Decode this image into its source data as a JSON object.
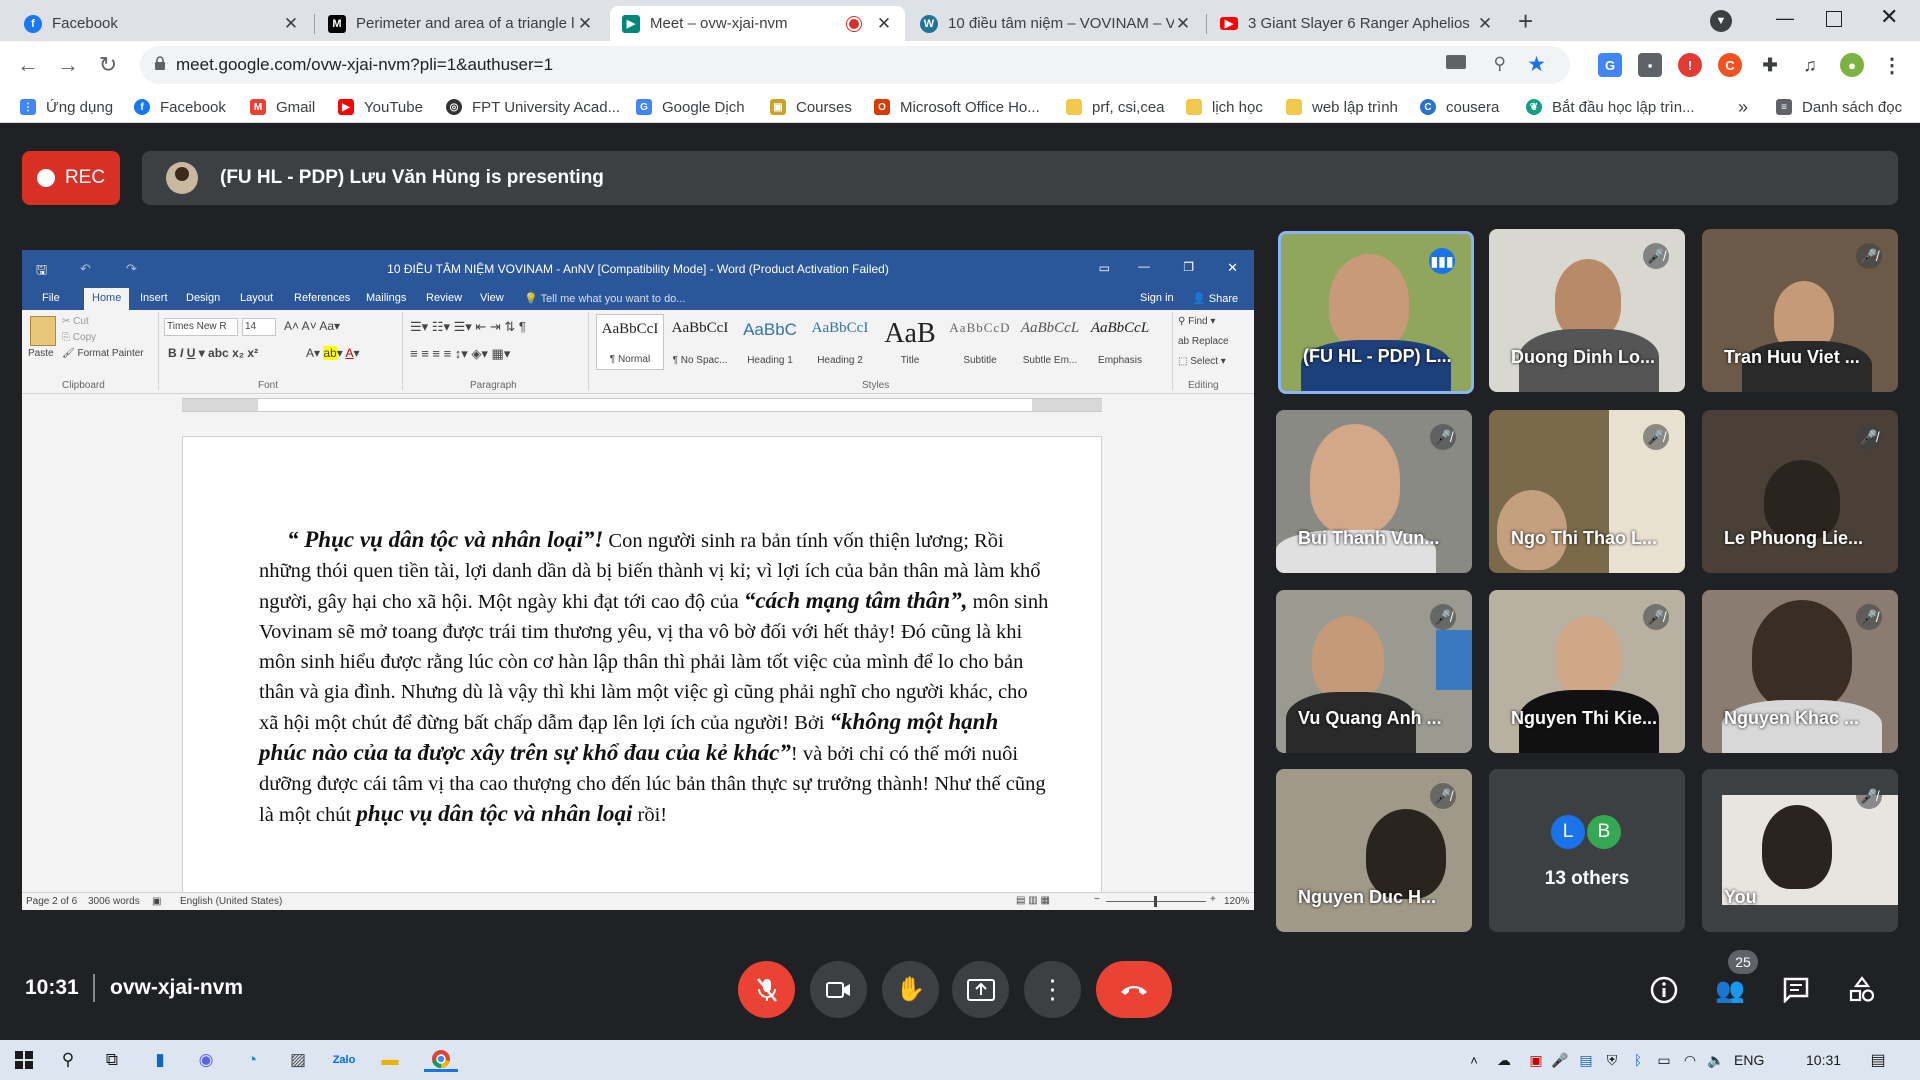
{
  "browser": {
    "tabs": [
      {
        "title": "Facebook",
        "icon": "facebook-icon",
        "color": "#1877f2",
        "glyph": "f"
      },
      {
        "title": "Perimeter and area of a triangle l",
        "icon": "mathway-icon",
        "color": "#000000",
        "glyph": "M"
      },
      {
        "title": "Meet – ovw-xjai-nvm",
        "icon": "meet-icon",
        "color": "#00897b",
        "glyph": "▶"
      },
      {
        "title": "10 điều tâm niệm – VOVINAM – V",
        "icon": "wordpress-icon",
        "color": "#21759b",
        "glyph": "W"
      },
      {
        "title": "3 Giant Slayer 6 Ranger Aphelios",
        "icon": "youtube-icon",
        "color": "#ff0000",
        "glyph": "▶"
      }
    ],
    "new_tab": "+",
    "url": "meet.google.com/ovw-xjai-nvm?pli=1&authuser=1",
    "bookmarks": [
      {
        "label": "Ứng dụng",
        "color": "#4285f4"
      },
      {
        "label": "Facebook",
        "color": "#1877f2"
      },
      {
        "label": "Gmail",
        "color": "#ea4335"
      },
      {
        "label": "YouTube",
        "color": "#ff0000"
      },
      {
        "label": "FPT University Acad...",
        "color": "#333333"
      },
      {
        "label": "Google Dịch",
        "color": "#4285f4"
      },
      {
        "label": "Courses",
        "color": "#c9a227"
      },
      {
        "label": "Microsoft Office Ho...",
        "color": "#d83b01"
      },
      {
        "label": "prf, csi,cea",
        "color": "#f2c94c"
      },
      {
        "label": "lịch học",
        "color": "#f2c94c"
      },
      {
        "label": "web lập trình",
        "color": "#f2c94c"
      },
      {
        "label": "cousera",
        "color": "#2a73cc"
      },
      {
        "label": "Bắt đầu học lập trìn...",
        "color": "#15a085"
      }
    ],
    "bookmarks_more": "»",
    "reading_list": "Danh sách đọc"
  },
  "meet": {
    "rec_label": "REC",
    "presenting": "(FU HL - PDP) Lưu Văn Hùng is presenting",
    "time": "10:31",
    "code": "ovw-xjai-nvm",
    "participants_count": "25",
    "others_label": "13 others",
    "others_avatars": [
      "L",
      "B"
    ],
    "tiles": [
      "(FU HL - PDP) L...",
      "Duong Dinh Lo...",
      "Tran Huu Viet ...",
      "Bui Thanh Vun...",
      "Ngo Thi Thao L...",
      "Le Phuong Lie...",
      "Vu Quang Anh ...",
      "Nguyen Thi Kie...",
      "Nguyen Khac ...",
      "Nguyen Duc H...",
      "You"
    ]
  },
  "word": {
    "title": "10 ĐIỀU TÂM NIỆM VOVINAM - AnNV [Compatibility Mode] - Word (Product Activation Failed)",
    "menu": [
      "File",
      "Home",
      "Insert",
      "Design",
      "Layout",
      "References",
      "Mailings",
      "Review",
      "View"
    ],
    "tell_me": "Tell me what you want to do...",
    "sign_in": "Sign in",
    "share": "Share",
    "clipboard": {
      "paste": "Paste",
      "cut": "Cut",
      "copy": "Copy",
      "format_painter": "Format Painter",
      "group": "Clipboard"
    },
    "font": {
      "name": "Times New R",
      "size": "14",
      "group": "Font"
    },
    "paragraph_group": "Paragraph",
    "styles_group": "Styles",
    "editing_group": "Editing",
    "styles": [
      {
        "sample": "AaBbCcI",
        "name": "¶ Normal"
      },
      {
        "sample": "AaBbCcI",
        "name": "¶ No Spac..."
      },
      {
        "sample": "AaBbC",
        "name": "Heading 1"
      },
      {
        "sample": "AaBbCcI",
        "name": "Heading 2"
      },
      {
        "sample": "AaB",
        "name": "Title"
      },
      {
        "sample": "AaBbCcD",
        "name": "Subtitle"
      },
      {
        "sample": "AaBbCcL",
        "name": "Subtle Em..."
      },
      {
        "sample": "AaBbCcL",
        "name": "Emphasis"
      }
    ],
    "editing": {
      "find": "Find",
      "replace": "Replace",
      "select": "Select"
    },
    "doc": {
      "b1": "“ Phục vụ dân tộc và nhân loại”!",
      "t1": " Con người sinh ra bản tính vốn thiện lương; Rồi những thói quen tiền tài, lợi danh dần dà bị biến thành vị kỉ; vì lợi ích của bản thân mà làm khổ người, gây hại cho xã hội. Một ngày khi đạt tới cao độ của ",
      "b2": "“cách mạng tâm thân”,",
      "t2": " môn sinh Vovinam sẽ mở toang được trái tim thương yêu, vị tha vô bờ đối với hết thảy!  Đó cũng là khi môn sinh hiểu được rằng lúc còn cơ hàn lập thân thì phải làm tốt việc của mình để lo cho bản thân và gia đình. Nhưng dù là vậy thì khi làm một việc gì cũng phải nghĩ cho người khác, cho xã hội một chút để đừng bất chấp dẫm đạp lên lợi ích của người! Bởi ",
      "b3": "“không một hạnh phúc nào của ta được xây trên sự khổ đau của kẻ khác”",
      "t3": "! và bởi chỉ có thế mới nuôi dưỡng được cái tâm vị tha cao thượng cho đến lúc bản thân thực sự trưởng thành! Như thế cũng là một chút ",
      "b4": "phục vụ dân tộc và nhân loại",
      "t4": " rồi!"
    },
    "status": {
      "page": "Page 2 of 6",
      "words": "3006 words",
      "lang": "English (United States)",
      "zoom": "120%"
    }
  },
  "taskbar": {
    "lang": "ENG",
    "time": "10:31"
  }
}
